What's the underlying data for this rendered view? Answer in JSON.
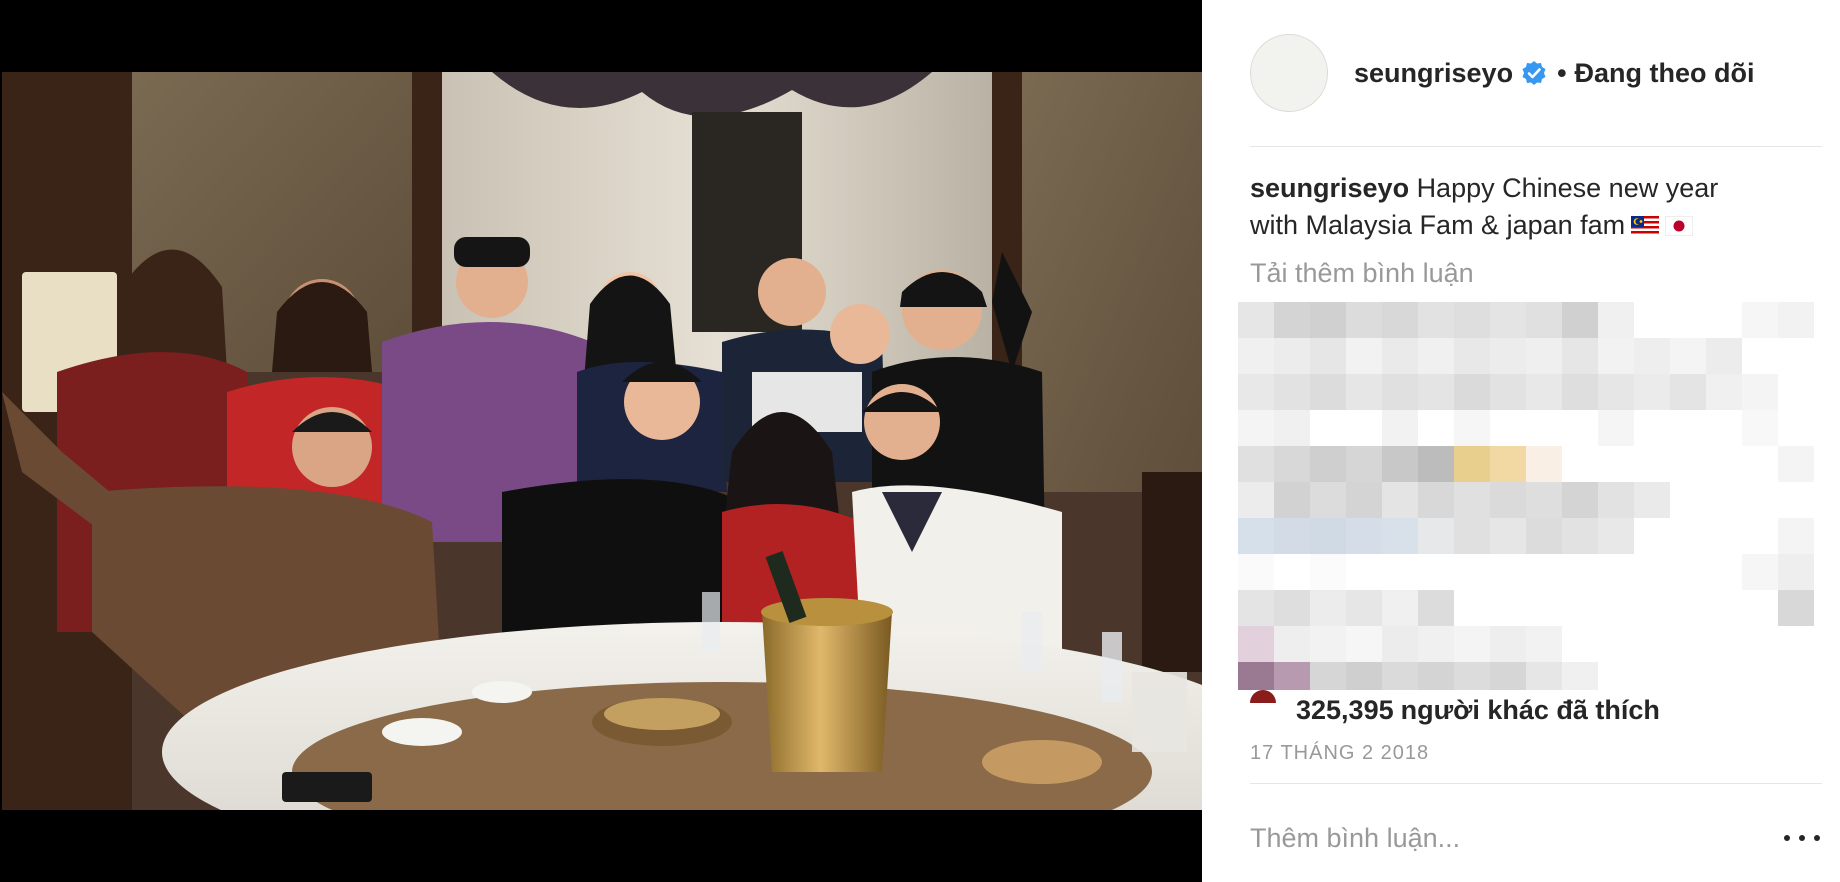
{
  "post": {
    "username": "seungriseyo",
    "verified": true,
    "separator": "•",
    "follow_status": "Đang theo dõi"
  },
  "caption": {
    "username": "seungriseyo",
    "text": "Happy Chinese new year with Malaysia Fam & japan fam",
    "emoji": [
      "malaysia-flag-icon",
      "japan-flag-icon"
    ]
  },
  "comments": {
    "load_more": "Tải thêm bình luận",
    "content_pixelated": true
  },
  "likes": {
    "count": "325,395",
    "suffix": "người khác đã thích"
  },
  "date": "17 THÁNG 2 2018",
  "comment_box": {
    "placeholder": "Thêm bình luận..."
  },
  "icons": {
    "verified": "verified-badge-icon",
    "more": "more-options-icon"
  },
  "colors": {
    "text": "#262626",
    "secondary_text": "#999999",
    "verified_blue": "#3897f0",
    "divider": "#e6e6e6"
  }
}
